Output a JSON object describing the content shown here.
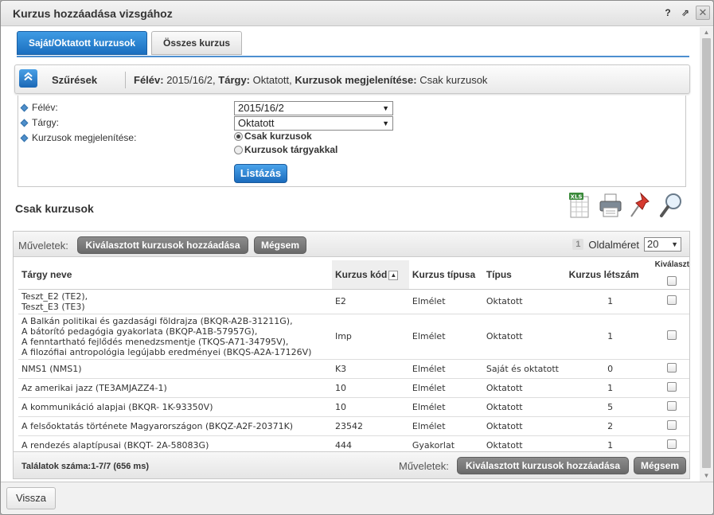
{
  "window": {
    "title": "Kurzus hozzáadása vizsgához",
    "help_glyph": "?",
    "popout_glyph": "⇗",
    "close_glyph": "✕"
  },
  "tabs": [
    {
      "label": "Saját/Oktatott kurzusok",
      "active": true
    },
    {
      "label": "Összes kurzus",
      "active": false
    }
  ],
  "filter": {
    "header_label": "Szűrések",
    "summary": {
      "semester_label": "Félév:",
      "semester_value": "2015/16/2",
      "subject_label": "Tárgy:",
      "subject_value": "Oktatott",
      "display_label": "Kurzusok megjelenítése:",
      "display_value": "Csak kurzusok"
    },
    "fields": {
      "semester_label": "Félév:",
      "semester_value": "2015/16/2",
      "subject_label": "Tárgy:",
      "subject_value": "Oktatott",
      "display_label": "Kurzusok megjelenítése:",
      "option1": "Csak kurzusok",
      "option2": "Kurzusok tárgyakkal"
    },
    "list_button": "Listázás"
  },
  "section_title": "Csak kurzusok",
  "toolbar_icons": [
    "excel-export-icon",
    "print-icon",
    "pin-icon",
    "search-magnifier-icon"
  ],
  "grid": {
    "ops_label": "Műveletek:",
    "add_selected": "Kiválasztott kurzusok hozzáadása",
    "cancel": "Mégsem",
    "page_number": "1",
    "page_size_label": "Oldalméret",
    "page_size_value": "20",
    "columns": {
      "subject": "Tárgy neve",
      "code": "Kurzus kód",
      "course_type": "Kurzus típusa",
      "type": "Típus",
      "headcount": "Kurzus létszám",
      "select": "Kiválaszt"
    },
    "rows": [
      {
        "subject": [
          "Teszt_E2 (TE2),",
          "Teszt_E3 (TE3)"
        ],
        "code": "E2",
        "course_type": "Elmélet",
        "type": "Oktatott",
        "headcount": "1"
      },
      {
        "subject": [
          "A Balkán politikai és gazdasági földrajza (BKQR-A2B-31211G),",
          "A bátorító pedagógia gyakorlata (BKQP-A1B-57957G),",
          "A fenntartható fejlődés menedzsmentje (TKQS-A71-34795V),",
          "A filozófiai antropológia legújabb eredményei (BKQS-A2A-17126V)"
        ],
        "code": "Imp",
        "course_type": "Elmélet",
        "type": "Oktatott",
        "headcount": "1"
      },
      {
        "subject": [
          "NMS1 (NMS1)"
        ],
        "code": "K3",
        "course_type": "Elmélet",
        "type": "Saját és oktatott",
        "headcount": "0"
      },
      {
        "subject": [
          "Az amerikai jazz (TE3AMJAZZ4-1)"
        ],
        "code": "10",
        "course_type": "Elmélet",
        "type": "Oktatott",
        "headcount": "1"
      },
      {
        "subject": [
          "A kommunikáció alapjai (BKQR- 1K-93350V)"
        ],
        "code": "10",
        "course_type": "Elmélet",
        "type": "Oktatott",
        "headcount": "5"
      },
      {
        "subject": [
          "A felsőoktatás története Magyarországon (BKQZ-A2F-20371K)"
        ],
        "code": "23542",
        "course_type": "Elmélet",
        "type": "Oktatott",
        "headcount": "2"
      },
      {
        "subject": [
          "A rendezés alaptípusai (BKQT- 2A-58083G)"
        ],
        "code": "444",
        "course_type": "Gyakorlat",
        "type": "Oktatott",
        "headcount": "1"
      }
    ],
    "results": "Találatok száma:1-7/7 (656 ms)"
  },
  "footer": {
    "back": "Vissza"
  },
  "colors": {
    "accent_blue": "#1b6fbf",
    "button_gray": "#6a6a6a"
  }
}
